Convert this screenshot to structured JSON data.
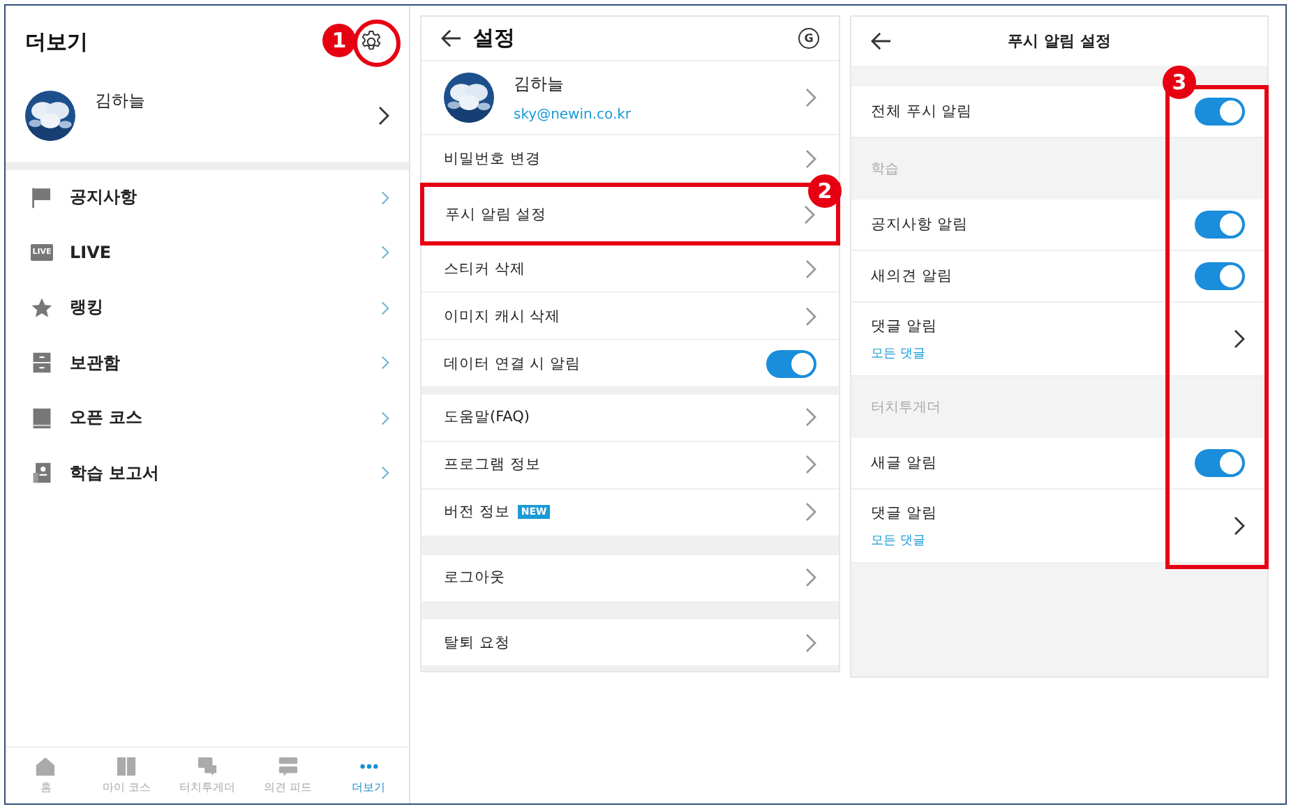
{
  "more_panel": {
    "title": "더보기",
    "profile": {
      "name": "김하늘"
    },
    "menu": [
      {
        "label": "공지사항"
      },
      {
        "label": "LIVE",
        "icon_text": "LIVE"
      },
      {
        "label": "랭킹"
      },
      {
        "label": "보관함"
      },
      {
        "label": "오픈 코스"
      },
      {
        "label": "학습 보고서"
      }
    ],
    "tab_bar": [
      {
        "label": "홈",
        "selected": false
      },
      {
        "label": "마이 코스",
        "selected": false
      },
      {
        "label": "터치투게더",
        "selected": false
      },
      {
        "label": "의견 피드",
        "selected": false
      },
      {
        "label": "더보기",
        "selected": true
      }
    ]
  },
  "settings_panel": {
    "title": "설정",
    "header_badge": "G",
    "profile": {
      "name": "김하늘",
      "email": "sky@newin.co.kr"
    },
    "groups": [
      [
        {
          "label": "비밀번호 변경",
          "kind": "link",
          "highlighted": false
        },
        {
          "label": "푸시 알림 설정",
          "kind": "link",
          "highlighted": true
        },
        {
          "label": "스티커 삭제",
          "kind": "link",
          "highlighted": false
        },
        {
          "label": "이미지 캐시 삭제",
          "kind": "link",
          "highlighted": false
        },
        {
          "label": "데이터 연결 시 알림",
          "kind": "toggle",
          "on": true,
          "highlighted": false
        }
      ],
      [
        {
          "label": "도움말(FAQ)",
          "kind": "link",
          "highlighted": false
        },
        {
          "label": "프로그램 정보",
          "kind": "link",
          "highlighted": false
        },
        {
          "label": "버전 정보",
          "kind": "link",
          "badge": "NEW",
          "highlighted": false
        }
      ],
      [
        {
          "label": "로그아웃",
          "kind": "link",
          "highlighted": false
        }
      ],
      [
        {
          "label": "탈퇴 요청",
          "kind": "link",
          "highlighted": false
        }
      ]
    ]
  },
  "push_panel": {
    "title": "푸시 알림 설정",
    "sections": [
      {
        "items": [
          {
            "label": "전체 푸시 알림",
            "kind": "toggle",
            "on": true
          }
        ]
      },
      {
        "header": "학습",
        "items": [
          {
            "label": "공지사항 알림",
            "kind": "toggle",
            "on": true
          },
          {
            "label": "새의견 알림",
            "kind": "toggle",
            "on": true
          },
          {
            "label": "댓글 알림",
            "kind": "link",
            "value": "모든 댓글"
          }
        ]
      },
      {
        "header": "터치투게더",
        "items": [
          {
            "label": "새글 알림",
            "kind": "toggle",
            "on": true
          },
          {
            "label": "댓글 알림",
            "kind": "link",
            "value": "모든 댓글"
          }
        ]
      }
    ]
  },
  "callouts": [
    {
      "label": "1"
    },
    {
      "label": "2"
    },
    {
      "label": "3"
    }
  ]
}
